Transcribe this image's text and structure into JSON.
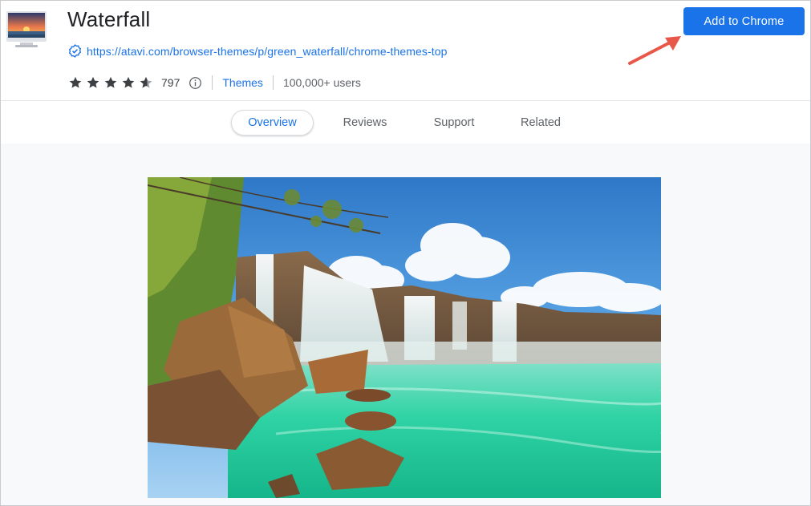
{
  "extension": {
    "title": "Waterfall",
    "website": "https://atavi.com/browser-themes/p/green_waterfall/chrome-themes-top",
    "rating": 4,
    "rating_count": "797",
    "category": "Themes",
    "users": "100,000+ users"
  },
  "actions": {
    "add_label": "Add to Chrome"
  },
  "tabs": [
    {
      "label": "Overview",
      "active": true
    },
    {
      "label": "Reviews",
      "active": false
    },
    {
      "label": "Support",
      "active": false
    },
    {
      "label": "Related",
      "active": false
    }
  ],
  "colors": {
    "accent": "#1a73e8",
    "annotation_arrow": "#e8584a",
    "star": "#3c4043"
  },
  "icons": {
    "verified": "verified-badge-icon",
    "info": "info-icon",
    "star": "star-icon"
  }
}
